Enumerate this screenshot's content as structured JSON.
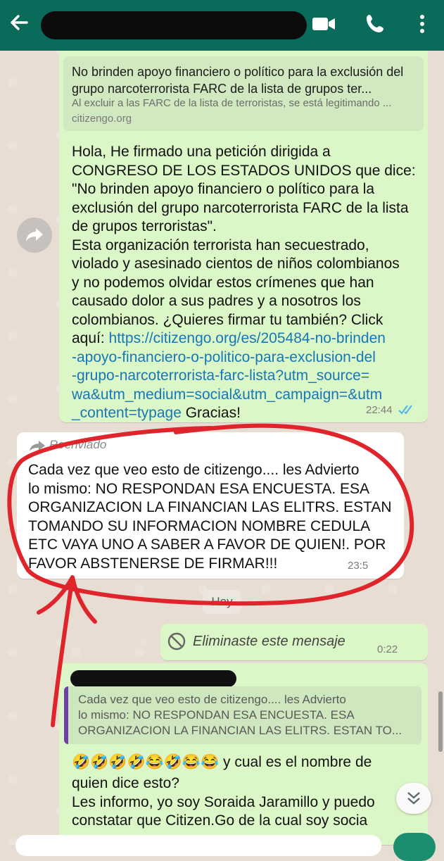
{
  "colors": {
    "header": "#0b6b5b",
    "outgoing": "#dcf7c7",
    "incoming": "#ffffff",
    "link": "#1777b6",
    "ticks": "#4fb3e6",
    "annotation": "#e0242c"
  },
  "header": {
    "icons": [
      "back-arrow-icon",
      "video-call-icon",
      "phone-icon",
      "more-vert-icon"
    ]
  },
  "message1": {
    "preview_title": "No brinden apoyo financiero o político para la exclusión del grupo narcoterrorista FARC de la lista de grupos ter...",
    "preview_desc": "Al excluir a las FARC de la lista de terroristas, se está legitimando ...",
    "preview_domain": "citizengo.org",
    "body": "Hola, He firmado una petición dirigida a\nCONGRESO DE LOS ESTADOS UNIDOS que dice:\n\"No brinden apoyo financiero o político para la\nexclusión del grupo narcoterrorista FARC de la lista\nde grupos terroristas\".\nEsta organización terrorista han secuestrado,\nviolado y asesinado cientos de niños colombianos\ny no podemos olvidar estos crímenes que han\ncausado dolor a sus padres y a nosotros los\ncolombianos. ¿Quieres firmar tu también? Click\naquí: ",
    "link": "https://citizengo.org/es/205484-no-brinden\n-apoyo-financiero-o-politico-para-exclusion-del\n-grupo-narcoterrorista-farc-lista?utm_source=\nwa&utm_medium=social&utm_campaign=&utm\n_content=typage",
    "tail": " Gracias!",
    "time": "22:44"
  },
  "message2": {
    "forwarded_label": "Reenviado",
    "body": "Cada vez que veo esto de citizengo.... les Advierto\nlo mismo: NO RESPONDAN ESA ENCUESTA. ESA\nORGANIZACION LA FINANCIAN LAS ELITRS. ESTAN\nTOMANDO SU INFORMACION NOMBRE CEDULA\nETC VAYA UNO A SABER A FAVOR DE QUIEN!. POR\nFAVOR ABSTENERSE DE FIRMAR!!!",
    "time": "23:5"
  },
  "date_chip": "Hoy",
  "deleted": {
    "text": "Eliminaste este mensaje",
    "time": "0:22"
  },
  "message3": {
    "quote_text": "Cada vez que veo esto de citizengo.... les Advierto\nlo mismo: NO RESPONDAN ESA ENCUESTA. ESA\nORGANIZACION LA FINANCIAN LAS ELITRS. ESTAN TO...",
    "emojis": "🤣🤣🤣🤣😂🤣😂😂",
    "body_after_emoji": " y cual es el nombre de",
    "body": "quien dice esto?\nLes informo, yo soy Soraida Jaramillo y puedo\nconstatar que Citizen.Go de la cual soy socia"
  }
}
